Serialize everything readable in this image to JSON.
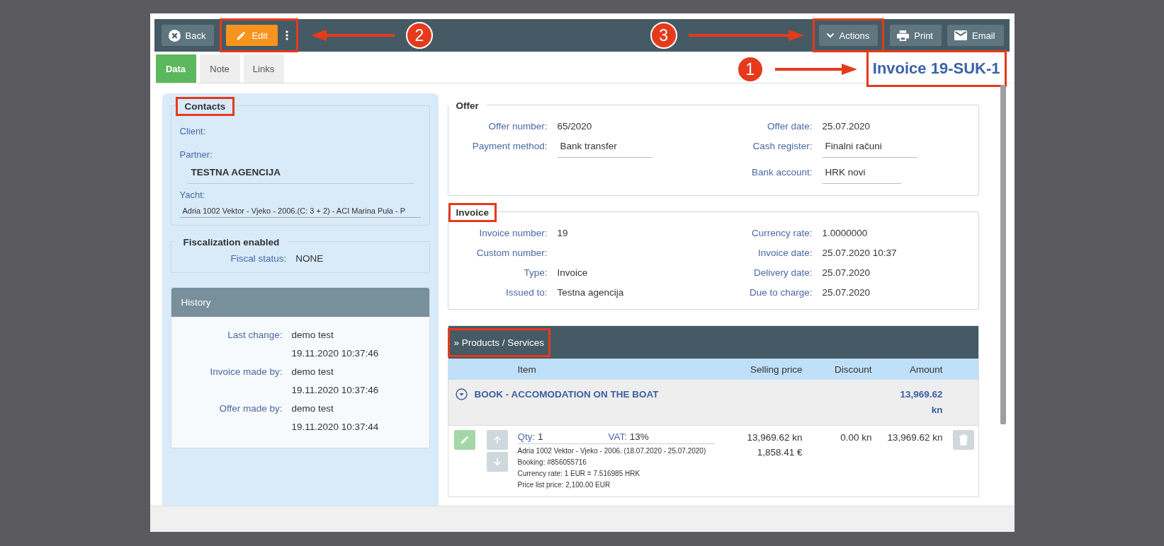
{
  "toolbar": {
    "back": "Back",
    "edit": "Edit",
    "edit_highlighted": true,
    "edit_callout": {
      "number": "2"
    },
    "actions_callout": {
      "number": "3"
    },
    "actions": "Actions",
    "actions_highlighted": true,
    "print": "Print",
    "email": "Email"
  },
  "tabs": [
    {
      "label": "Data",
      "selected": true
    },
    {
      "label": "Note",
      "selected": false
    },
    {
      "label": "Links",
      "selected": false
    }
  ],
  "title": {
    "text": "Invoice 19-SUK-1",
    "highlighted": true,
    "callout": {
      "number": "1"
    }
  },
  "contacts": {
    "legend": "Contacts",
    "highlighted": true,
    "fields": [
      {
        "label": "Client:",
        "kind": "empty"
      },
      {
        "label": "Partner:",
        "value": "TESTNA AGENCIJA",
        "kind": "bold"
      },
      {
        "label": "Yacht:",
        "value": "Adria 1002 Vektor - Vjeko - 2006.(C: 3 + 2) - ACI Marina Pula - P",
        "kind": "small"
      }
    ]
  },
  "fiscal": {
    "legend": "Fiscalization enabled",
    "label": "Fiscal status:",
    "value": "NONE"
  },
  "history": {
    "title": "History",
    "rows": [
      {
        "label": "Last change:",
        "user": "demo test",
        "time": "19.11.2020 10:37:46"
      },
      {
        "label": "Invoice made by:",
        "user": "demo test",
        "time": "19.11.2020 10:37:46"
      },
      {
        "label": "Offer made by:",
        "user": "demo test",
        "time": "19.11.2020 10:37:44"
      }
    ]
  },
  "offer": {
    "legend": "Offer",
    "highlighted": false,
    "left": [
      {
        "label": "Offer number:",
        "value": "65/2020",
        "kind": "plain"
      },
      {
        "label": "Payment method:",
        "value": "Bank transfer",
        "kind": "field"
      }
    ],
    "right": [
      {
        "label": "Offer date:",
        "value": "25.07.2020",
        "kind": "plain"
      },
      {
        "label": "Cash register:",
        "value": "Finalni računi",
        "kind": "field"
      },
      {
        "label": "Bank account:",
        "value": "HRK novi",
        "kind": "field"
      }
    ]
  },
  "invoice": {
    "legend": "Invoice",
    "highlighted": true,
    "left": [
      {
        "label": "Invoice number:",
        "value": "19",
        "kind": "plain"
      },
      {
        "label": "Custom number:",
        "kind": "plain"
      },
      {
        "label": "Type:",
        "value": "Invoice",
        "kind": "plain"
      },
      {
        "label": "Issued to:",
        "value": "Testna agencija",
        "kind": "plain"
      }
    ],
    "right": [
      {
        "label": "Currency rate:",
        "value": "1.0000000",
        "kind": "plain"
      },
      {
        "label": "Invoice date:",
        "value": "25.07.2020 10:37",
        "kind": "plain"
      },
      {
        "label": "Delivery date:",
        "value": "25.07.2020",
        "kind": "plain"
      },
      {
        "label": "Due to charge:",
        "value": "25.07.2020",
        "kind": "plain"
      }
    ]
  },
  "products": {
    "title": "» Products / Services",
    "highlighted": true,
    "columns": [
      "Item",
      "Selling price",
      "Discount",
      "Amount"
    ],
    "group": {
      "name": "BOOK - ACCOMODATION ON THE BOAT",
      "amount": "13,969.62 kn"
    },
    "items": [
      {
        "qty_label": "Qty:",
        "qty": "1",
        "vat_label": "VAT:",
        "vat": "13%",
        "details": [
          "Adria 1002 Vektor - Vjeko - 2006. (18.07.2020 - 25.07.2020)",
          "Booking: #856055716",
          "Currency rate: 1 EUR = 7.516985 HRK",
          "Price list price: 2,100.00 EUR"
        ],
        "price": "13,969.62 kn",
        "price_eur": "1,858.41 €",
        "discount": "0.00 kn",
        "amount": "13,969.62 kn"
      }
    ]
  }
}
